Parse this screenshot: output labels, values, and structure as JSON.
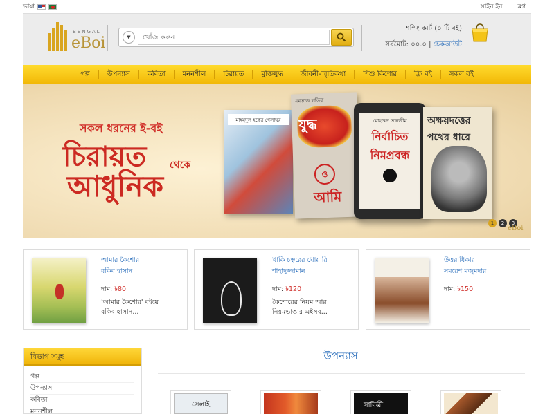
{
  "topbar": {
    "language_label": "ভাষা",
    "flags": [
      "us-flag-icon",
      "bangladesh-flag-icon"
    ],
    "signin": "সাইন ইন",
    "blog": "ব্লগ"
  },
  "header": {
    "logo_sub": "BENGAL",
    "logo_main": "eBoi",
    "search_placeholder": "খোঁজ করুন",
    "search_icon": "search-icon",
    "cart": {
      "label": "শপিং কার্ট",
      "count_text": "(০ টি বই)",
      "total_label": "সর্বমোট:",
      "total_value": "০০.০",
      "checkout": "চেকআউট",
      "icon": "shopping-bag-icon"
    }
  },
  "nav": {
    "items": [
      "গল্প",
      "উপন্যাস",
      "কবিতা",
      "মননশীল",
      "চিরায়ত",
      "মুক্তিযুদ্ধ",
      "জীবনী-স্মৃতিকথা",
      "শিশু কিশোর",
      "ফ্রি বই",
      "সকল বই"
    ]
  },
  "banner": {
    "tagline": "সকল ধরনের ই-বই",
    "line1": "চিরায়ত",
    "line_mid": "থেকে",
    "line2": "আধুনিক",
    "book1_title": "মাহমুদুল হকের খেলাঘর",
    "book2_author": "মমতাজ লতিফ",
    "book2_title": "যুদ্ধ",
    "book2_o": "ও",
    "book2_title2": "আমি",
    "tablet_author": "মোহাম্মদ তানজীম",
    "tablet_title": "নির্বাচিত নিমপ্রবন্ধ",
    "book4_title": "অক্ষয়দত্তের পথের ধারে",
    "slider_dots": [
      "1",
      "2",
      "3"
    ],
    "active_dot": 1,
    "logo": "eBoi",
    "colors": {
      "accent": "#cc2a22",
      "gold": "#d9a520"
    }
  },
  "featured": [
    {
      "title": "আমার কৈশোর",
      "author": "রকিব হাসান",
      "price_label": "দাম:",
      "price": "৳80",
      "desc1": "'আমার কৈশোর' বইয়ে",
      "desc2": "রকিব হাসান..."
    },
    {
      "title": "খাকি চত্বরের খোয়ারি",
      "author": "শাহাদুজ্জামান",
      "price_label": "দাম:",
      "price": "৳120",
      "desc1": "কৈশোরের নিয়ম আর",
      "desc2": "নিয়মভাঙার এইসব..."
    },
    {
      "title": "উত্তরাধিকার",
      "author": "সমরেশ মজুমদার",
      "price_label": "দাম:",
      "price": "৳150",
      "desc1": "",
      "desc2": ""
    }
  ],
  "sidebar": {
    "title": "বিভাগ সমূহ",
    "items": [
      "গল্প",
      "উপন্যাস",
      "কবিতা",
      "মননশীল"
    ]
  },
  "section": {
    "title": "উপন্যাস",
    "grid": [
      {
        "cover_text": "সেলাই"
      },
      {
        "cover_text": ""
      },
      {
        "cover_text": "সাবিত্রী"
      },
      {
        "cover_text": ""
      }
    ]
  }
}
